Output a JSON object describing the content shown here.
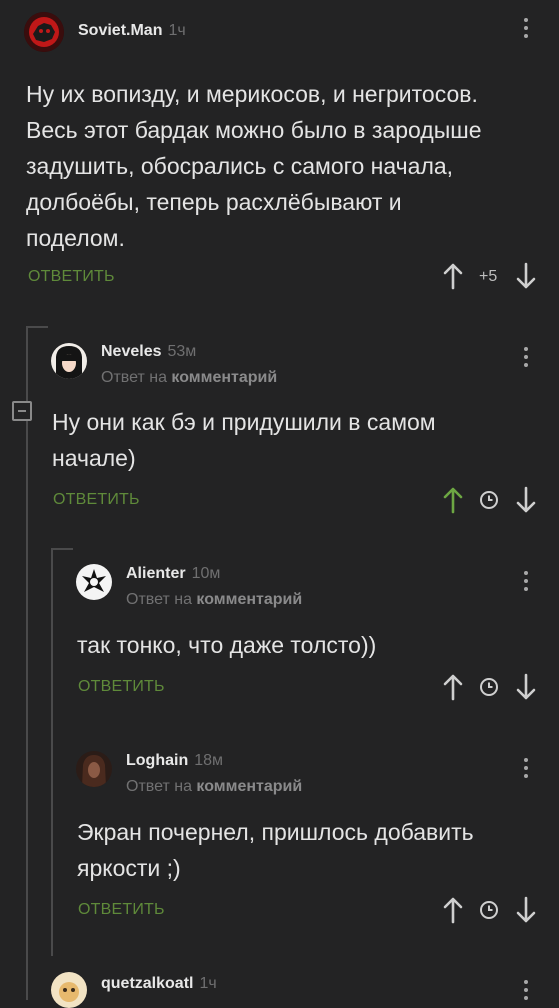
{
  "comments": [
    {
      "author": "Soviet.Man",
      "time": "1ч",
      "text_lines": [
        "Ну их вопизду, и мерикосов, и негритосов.",
        "Весь этот бардак можно было в зародыше",
        "задушить, обосрались с самого начала,",
        "долбоёбы, теперь расхлёбывают и",
        "поделом."
      ],
      "reply_label": "ОТВЕТИТЬ",
      "rating": "+5"
    },
    {
      "author": "Neveles",
      "time": "53м",
      "reply_prefix": "Ответ на",
      "reply_target": "комментарий",
      "text_lines": [
        "Ну они как бэ и придушили в самом",
        "начале)"
      ],
      "reply_label": "ОТВЕТИТЬ"
    },
    {
      "author": "Alienter",
      "time": "10м",
      "reply_prefix": "Ответ на",
      "reply_target": "комментарий",
      "text_lines": [
        "так тонко, что даже толсто))"
      ],
      "reply_label": "ОТВЕТИТЬ"
    },
    {
      "author": "Loghain",
      "time": "18м",
      "reply_prefix": "Ответ на",
      "reply_target": "комментарий",
      "text_lines": [
        "Экран почернел, пришлось добавить",
        "яркости ;)"
      ],
      "reply_label": "ОТВЕТИТЬ"
    },
    {
      "author": "quetzalkoatl",
      "time": "1ч"
    }
  ],
  "colors": {
    "background": "#232324",
    "reply_green": "#5f8a3a",
    "upvoted_green": "#6da743",
    "thread_line": "#4a4a4b"
  },
  "icons": [
    "upvote-arrow-icon",
    "downvote-arrow-icon",
    "clock-icon",
    "more-vertical-icon",
    "collapse-icon"
  ]
}
